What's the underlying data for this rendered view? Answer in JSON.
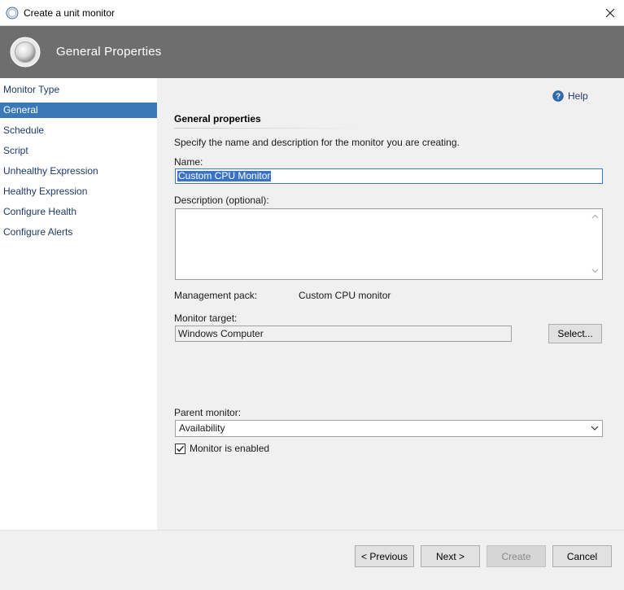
{
  "window": {
    "title": "Create a unit monitor",
    "close_icon": "close-icon",
    "app_icon": "monitor-circle-icon"
  },
  "banner": {
    "title": "General Properties",
    "logo_icon": "monitor-circle-icon",
    "background": "#6e6e6e"
  },
  "sidebar": {
    "items": [
      {
        "label": "Monitor Type",
        "active": false
      },
      {
        "label": "General",
        "active": true
      },
      {
        "label": "Schedule",
        "active": false
      },
      {
        "label": "Script",
        "active": false
      },
      {
        "label": "Unhealthy Expression",
        "active": false
      },
      {
        "label": "Healthy Expression",
        "active": false
      },
      {
        "label": "Configure Health",
        "active": false
      },
      {
        "label": "Configure Alerts",
        "active": false
      }
    ],
    "active_color": "#3b78b8"
  },
  "main": {
    "help_label": "Help",
    "help_icon": "help-icon",
    "section_title": "General properties",
    "description": "Specify the name and description for the monitor you are creating.",
    "name_label": "Name:",
    "name_value": "Custom CPU Monitor",
    "description_label": "Description (optional):",
    "description_value": "",
    "management_pack_label": "Management pack:",
    "management_pack_value": "Custom CPU monitor",
    "monitor_target_label": "Monitor target:",
    "monitor_target_value": "Windows Computer",
    "select_button": "Select...",
    "parent_monitor_label": "Parent monitor:",
    "parent_monitor_value": "Availability",
    "enabled_label": "Monitor is enabled",
    "enabled_checked": true
  },
  "footer": {
    "previous": "< Previous",
    "next": "Next >",
    "create": "Create",
    "cancel": "Cancel"
  }
}
